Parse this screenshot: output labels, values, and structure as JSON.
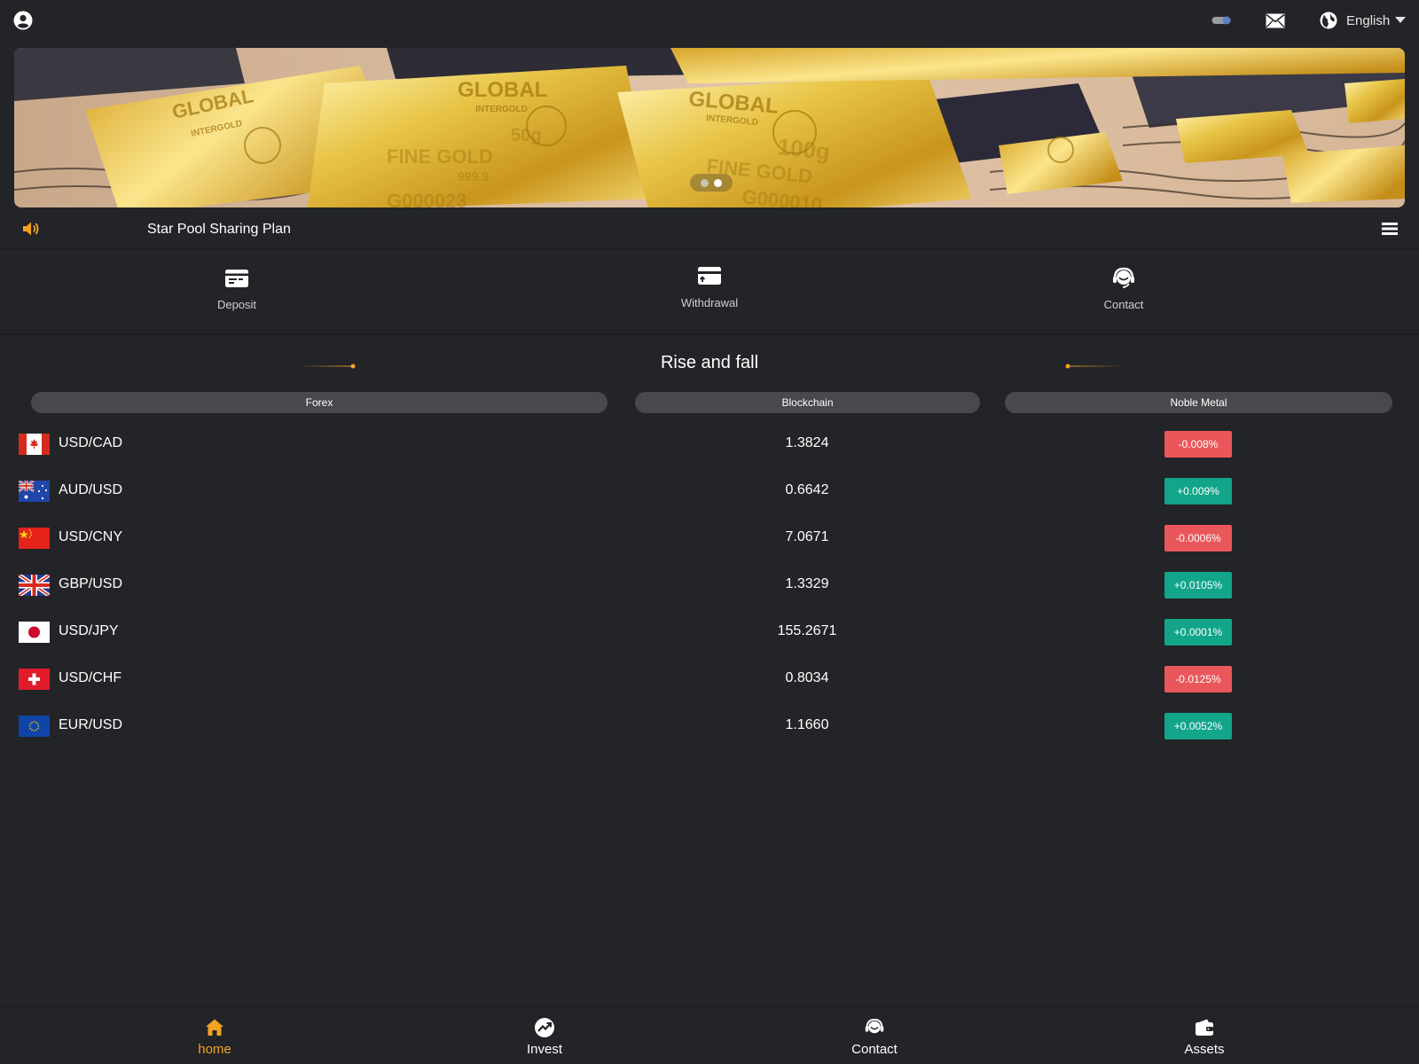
{
  "topbar": {
    "language_label": "English"
  },
  "banner": {
    "slide_count": 2,
    "active_slide": 2,
    "bar_texts": [
      "GLOBAL",
      "INTERGOLD",
      "50g",
      "FINE GOLD",
      "999.9",
      "G000023",
      "100g",
      "G000010"
    ]
  },
  "notice": {
    "text": "Star Pool Sharing Plan"
  },
  "actions": [
    {
      "label": "Deposit",
      "icon": "deposit-icon"
    },
    {
      "label": "Withdrawal",
      "icon": "withdrawal-icon"
    },
    {
      "label": "Contact",
      "icon": "headset-icon"
    }
  ],
  "section": {
    "title": "Rise and fall"
  },
  "tabs": [
    {
      "label": "Forex"
    },
    {
      "label": "Blockchain"
    },
    {
      "label": "Noble Metal"
    }
  ],
  "rows": [
    {
      "pair": "USD/CAD",
      "price": "1.3824",
      "change": "-0.008%",
      "direction": "down",
      "flag": "canada"
    },
    {
      "pair": "AUD/USD",
      "price": "0.6642",
      "change": "+0.009%",
      "direction": "up",
      "flag": "australia"
    },
    {
      "pair": "USD/CNY",
      "price": "7.0671",
      "change": "-0.0006%",
      "direction": "down",
      "flag": "china"
    },
    {
      "pair": "GBP/USD",
      "price": "1.3329",
      "change": "+0.0105%",
      "direction": "up",
      "flag": "uk"
    },
    {
      "pair": "USD/JPY",
      "price": "155.2671",
      "change": "+0.0001%",
      "direction": "up",
      "flag": "japan"
    },
    {
      "pair": "USD/CHF",
      "price": "0.8034",
      "change": "-0.0125%",
      "direction": "down",
      "flag": "switzerland"
    },
    {
      "pair": "EUR/USD",
      "price": "1.1660",
      "change": "+0.0052%",
      "direction": "up",
      "flag": "eu"
    }
  ],
  "bottom_nav": [
    {
      "label": "home",
      "icon": "home-icon",
      "active": true
    },
    {
      "label": "Invest",
      "icon": "invest-icon",
      "active": false
    },
    {
      "label": "Contact",
      "icon": "headset-icon",
      "active": false
    },
    {
      "label": "Assets",
      "icon": "wallet-icon",
      "active": false
    }
  ],
  "colors": {
    "background": "#232427",
    "accent": "#f2a324",
    "up": "#12a58a",
    "down": "#e9575a",
    "tab": "#48494c"
  }
}
